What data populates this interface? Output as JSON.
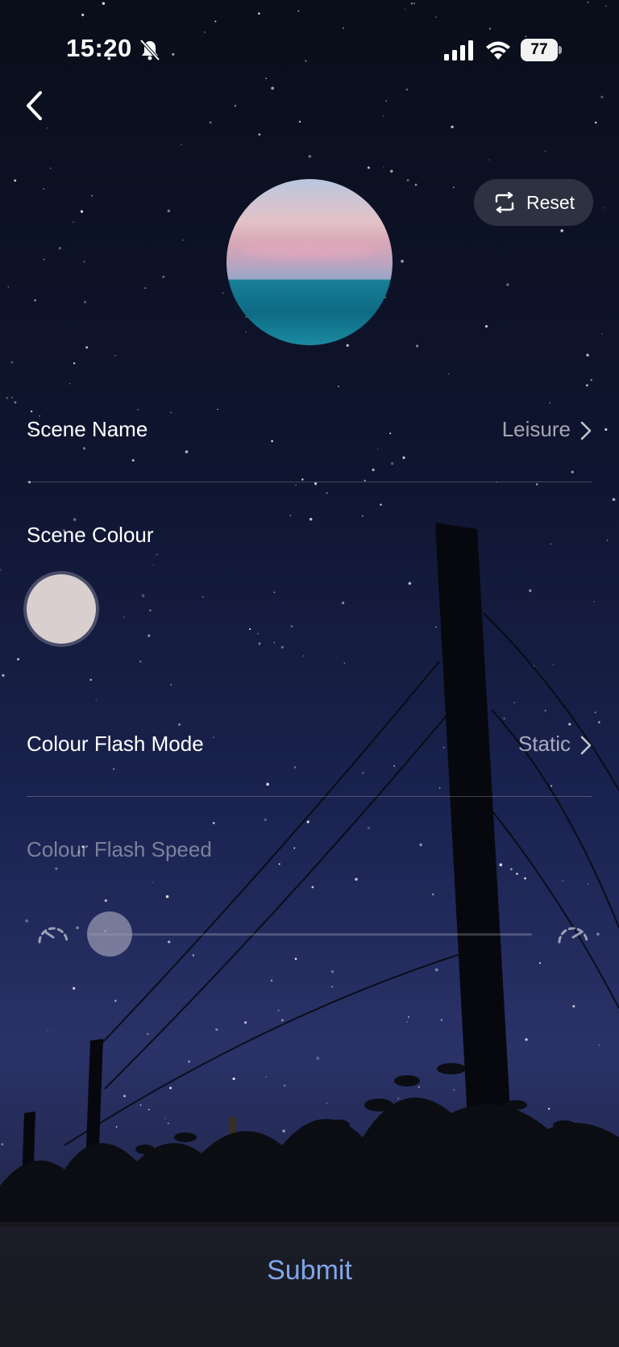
{
  "status_bar": {
    "time": "15:20",
    "battery": "77",
    "icons": [
      "bell-slash-icon",
      "cellular-signal-icon",
      "wifi-icon",
      "battery-icon"
    ]
  },
  "nav": {
    "back_icon": "chevron-left-icon"
  },
  "header": {
    "reset_label": "Reset",
    "reset_icon": "loop-arrows-icon"
  },
  "scene_preview": {
    "icon": "ocean-sunset-image"
  },
  "scene_name": {
    "label": "Scene Name",
    "value": "Leisure"
  },
  "scene_colour": {
    "label": "Scene Colour",
    "color": "#d9cfcf"
  },
  "flash_mode": {
    "label": "Colour Flash Mode",
    "value": "Static"
  },
  "flash_speed": {
    "label": "Colour Flash Speed",
    "value": 0,
    "disabled": true,
    "slow_icon": "speedometer-slow-icon",
    "fast_icon": "speedometer-fast-icon"
  },
  "footer": {
    "submit_label": "Submit",
    "accent_color": "#7fa6e8"
  }
}
